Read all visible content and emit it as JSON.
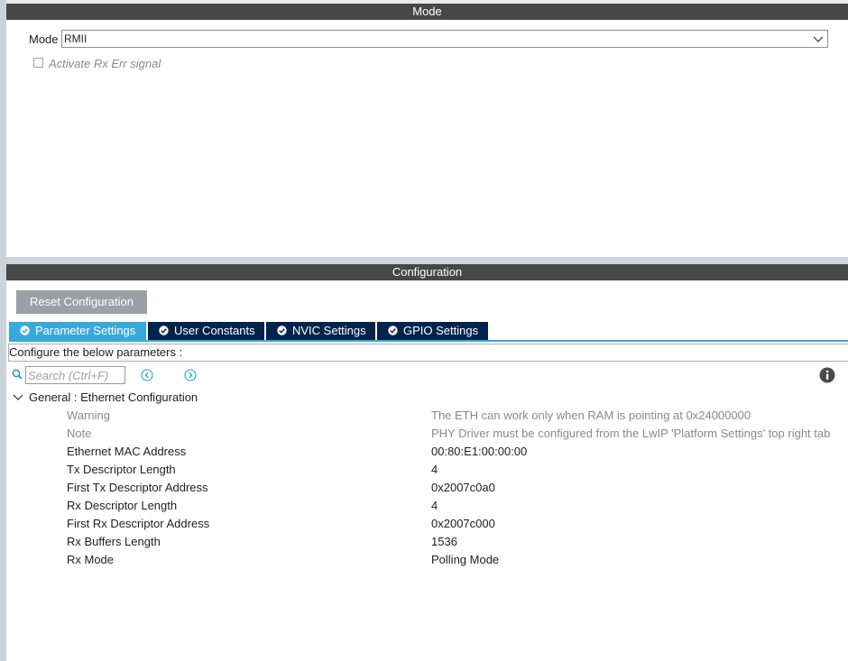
{
  "mode_panel": {
    "header": "Mode",
    "mode_label": "Mode",
    "mode_value": "RMII",
    "rx_err_label": "Activate Rx Err signal"
  },
  "config_panel": {
    "header": "Configuration",
    "reset_button": "Reset Configuration",
    "tabs": [
      {
        "label": "Parameter Settings",
        "active": true
      },
      {
        "label": "User Constants",
        "active": false
      },
      {
        "label": "NVIC Settings",
        "active": false
      },
      {
        "label": "GPIO Settings",
        "active": false
      }
    ],
    "configure_text": "Configure the below parameters :",
    "search_placeholder": "Search (Ctrl+F)",
    "group_title": "General : Ethernet Configuration",
    "params": [
      {
        "name": "Warning",
        "value": "The ETH can work only when RAM is pointing at 0x24000000",
        "muted": true
      },
      {
        "name": "Note",
        "value": "PHY Driver must be configured from the LwIP 'Platform Settings' top right tab",
        "muted": true
      },
      {
        "name": "Ethernet MAC Address",
        "value": "00:80:E1:00:00:00",
        "muted": false
      },
      {
        "name": "Tx Descriptor Length",
        "value": "4",
        "muted": false
      },
      {
        "name": "First Tx Descriptor Address",
        "value": "0x2007c0a0",
        "muted": false
      },
      {
        "name": "Rx Descriptor Length",
        "value": "4",
        "muted": false
      },
      {
        "name": "First Rx Descriptor Address",
        "value": "0x2007c000",
        "muted": false
      },
      {
        "name": "Rx Buffers Length",
        "value": "1536",
        "muted": false
      },
      {
        "name": "Rx Mode",
        "value": "Polling Mode",
        "muted": false
      }
    ]
  },
  "colors": {
    "header_bg": "#474747",
    "tab_active": "#39a9dc",
    "tab_inactive": "#03234b",
    "reset_button_bg": "#9aa0a6"
  },
  "icons": {
    "tab_icon": "check-circle-icon",
    "search": "search-icon",
    "prev": "chevron-left-circle-icon",
    "next": "chevron-right-circle-icon",
    "info": "info-icon",
    "expand": "chevron-down-icon"
  }
}
